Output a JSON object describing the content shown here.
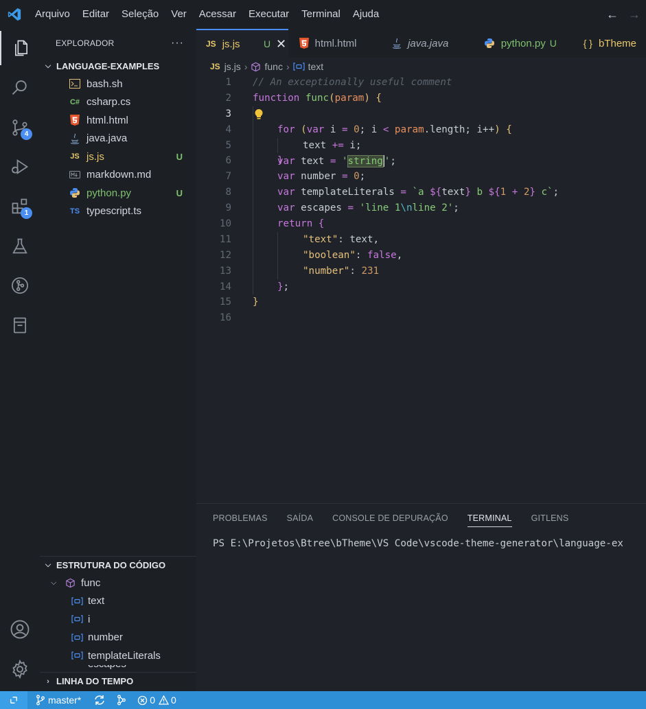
{
  "menu": [
    "Arquivo",
    "Editar",
    "Seleção",
    "Ver",
    "Acessar",
    "Executar",
    "Terminal",
    "Ajuda"
  ],
  "activity_badges": {
    "source_control": "4",
    "extensions": "1"
  },
  "sidebar": {
    "title": "EXPLORADOR",
    "folder": "LANGUAGE-EXAMPLES",
    "files": [
      {
        "name": "bash.sh",
        "icon": "terminal-icon",
        "status": ""
      },
      {
        "name": "csharp.cs",
        "icon": "csharp-icon",
        "status": ""
      },
      {
        "name": "html.html",
        "icon": "html5-icon",
        "status": ""
      },
      {
        "name": "java.java",
        "icon": "java-icon",
        "status": ""
      },
      {
        "name": "js.js",
        "icon": "javascript-icon",
        "status": "U"
      },
      {
        "name": "markdown.md",
        "icon": "markdown-icon",
        "status": ""
      },
      {
        "name": "python.py",
        "icon": "python-icon",
        "status": "U"
      },
      {
        "name": "typescript.ts",
        "icon": "typescript-icon",
        "status": ""
      }
    ],
    "outline_title": "ESTRUTURA DO CÓDIGO",
    "outline": {
      "root": "func",
      "children": [
        "text",
        "i",
        "number",
        "templateLiterals",
        "escapes"
      ]
    },
    "timeline_title": "LINHA DO TEMPO"
  },
  "tabs": [
    {
      "label": "js.js",
      "status": "U",
      "active": true
    },
    {
      "label": "html.html"
    },
    {
      "label": "java.java"
    },
    {
      "label": "python.py",
      "status": "U"
    },
    {
      "label": "bTheme"
    }
  ],
  "icons": {
    "js": "JS",
    "csharp": "C#",
    "typescript": "TS",
    "json_braces": "{ }"
  },
  "breadcrumb": [
    "js.js",
    "func",
    "text"
  ],
  "code": {
    "line_numbers": [
      "1",
      "2",
      "3",
      "4",
      "5",
      "6",
      "7",
      "8",
      "9",
      "10",
      "11",
      "12",
      "13",
      "14",
      "15",
      "16"
    ],
    "current_line": 3,
    "l1": "// An exceptionally useful comment",
    "l2": {
      "kw": "function",
      "name": "func",
      "param": "param"
    },
    "l3": {
      "kw": "var",
      "id": "text",
      "str_open": "'",
      "str_sel": "string",
      "str_close": "'"
    },
    "l4": {
      "kw": "for",
      "kw2": "var",
      "i": "i",
      "zero": "0",
      "param": "param",
      "length": "length",
      "inc": "i++"
    },
    "l5": {
      "id": "text",
      "op": "+=",
      "i": "i"
    },
    "l7": {
      "kw": "var",
      "id": "number",
      "val": "0"
    },
    "l8": {
      "kw": "var",
      "id": "templateLiterals",
      "t1": "`a ",
      "v1": "text",
      "t2": " b ",
      "n1": "1",
      "n2": "2",
      "t3": " c`"
    },
    "l9": {
      "kw": "var",
      "id": "escapes",
      "s1": "'line 1",
      "esc": "\\n",
      "s2": "line 2'"
    },
    "l10": "return",
    "l11": {
      "key": "\"text\"",
      "val": "text"
    },
    "l12": {
      "key": "\"boolean\"",
      "val": "false"
    },
    "l13": {
      "key": "\"number\"",
      "val": "231"
    }
  },
  "panel": {
    "tabs": [
      "PROBLEMAS",
      "SAÍDA",
      "CONSOLE DE DEPURAÇÃO",
      "TERMINAL",
      "GITLENS"
    ],
    "active_tab": "TERMINAL",
    "terminal_text": "PS E:\\Projetos\\Btree\\bTheme\\VS Code\\vscode-theme-generator\\language-ex"
  },
  "statusbar": {
    "branch": "master*",
    "errors": "0",
    "warnings": "0",
    "color": "#2f8fd6"
  }
}
